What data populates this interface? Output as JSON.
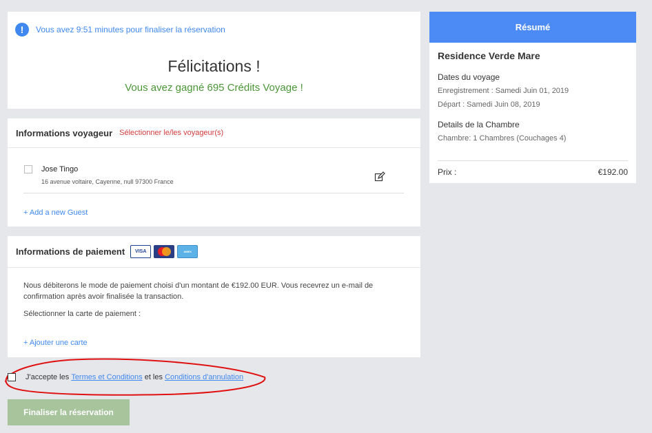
{
  "timer": {
    "text": "Vous avez 9:51 minutes pour finaliser la réservation",
    "icon": "!"
  },
  "congrats": {
    "title": "Félicitations !",
    "subtitle": "Vous avez gagné 695 Crédits Voyage !"
  },
  "travellers": {
    "title": "Informations voyageur",
    "select_link": "Sélectionner le/les voyageur(s)",
    "guests": [
      {
        "name": "Jose Tingo",
        "address": "16 avenue voltaire, Cayenne, null 97300 France"
      }
    ],
    "add_guest": "+ Add a new Guest"
  },
  "payment": {
    "title": "Informations de paiement",
    "cards": [
      "VISA",
      "MasterCard",
      "AMERICAN EXPRESS"
    ],
    "description": "Nous débiterons le mode de paiement choisi d'un montant de €192.00 EUR. Vous recevrez un e-mail de confirmation après avoir finalisée la transaction.",
    "select_card": "Sélectionner la carte de paiement :",
    "add_card": "+ Ajouter une carte"
  },
  "terms": {
    "prefix": "J'accepte les",
    "terms_link": "Termes et Conditions",
    "middle": "et les",
    "cancel_link": "Conditions d'annulation"
  },
  "finalize_button": "Finaliser la réservation",
  "summary": {
    "header": "Résumé",
    "hotel": "Residence Verde Mare",
    "dates_title": "Dates du voyage",
    "checkin": "Enregistrement : Samedi Juin 01, 2019",
    "checkout": "Départ : Samedi Juin 08, 2019",
    "room_title": "Details de la Chambre",
    "room": "Chambre: 1 Chambres (Couchages 4)",
    "price_label": "Prix :",
    "price_value": "€192.00"
  },
  "colors": {
    "accent": "#3f88f0",
    "success": "#4a9636",
    "error": "#d33b3b",
    "summary_header": "#4c8bf5",
    "button_disabled": "#a7c49d",
    "annotation": "#e01010"
  }
}
